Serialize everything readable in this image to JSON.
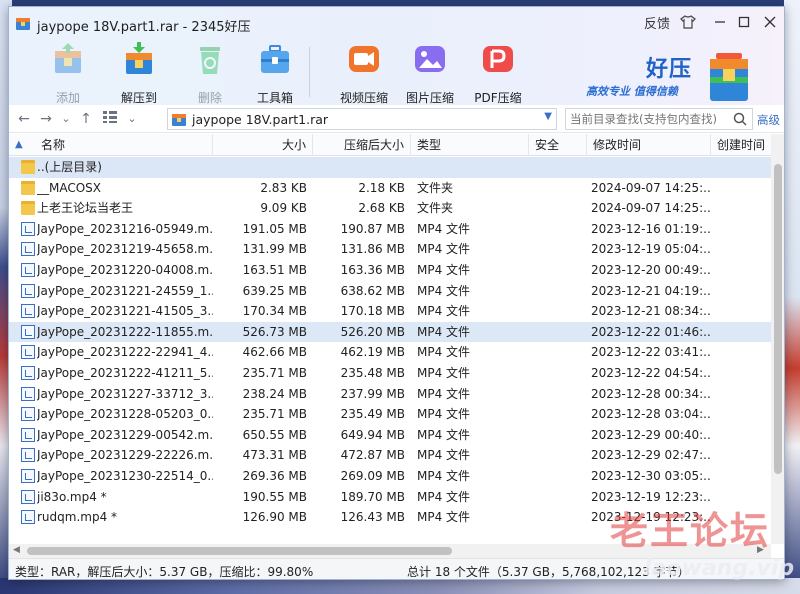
{
  "window": {
    "title": "jaypope 18V.part1.rar - 2345好压",
    "feedback": "反馈"
  },
  "toolbar": {
    "items": [
      {
        "label": "添加",
        "icon": "add-archive-icon",
        "disabled": true
      },
      {
        "label": "解压到",
        "icon": "extract-to-icon",
        "disabled": false
      },
      {
        "label": "删除",
        "icon": "delete-recycle-icon",
        "disabled": true
      },
      {
        "label": "工具箱",
        "icon": "toolbox-icon",
        "disabled": false
      },
      {
        "label": "视频压缩",
        "icon": "video-compress-icon",
        "disabled": false
      },
      {
        "label": "图片压缩",
        "icon": "image-compress-icon",
        "disabled": false
      },
      {
        "label": "PDF压缩",
        "icon": "pdf-compress-icon",
        "disabled": false
      }
    ]
  },
  "brand": {
    "name": "好压",
    "slogan": "高效专业 值得信赖"
  },
  "address": {
    "path": "jaypope 18V.part1.rar",
    "search_placeholder": "当前目录查找(支持包内查找)",
    "advanced": "高级"
  },
  "columns": {
    "name": "名称",
    "size": "大小",
    "packed": "压缩后大小",
    "type": "类型",
    "security": "安全",
    "modified": "修改时间",
    "created": "创建时间"
  },
  "rows": [
    {
      "name": "..(上层目录)",
      "size": "",
      "packed": "",
      "type": "",
      "modified": "",
      "kind": "folder"
    },
    {
      "name": "__MACOSX",
      "size": "2.83 KB",
      "packed": "2.18 KB",
      "type": "文件夹",
      "modified": "2024-09-07 14:25:...",
      "kind": "folder"
    },
    {
      "name": "上老王论坛当老王",
      "size": "9.09 KB",
      "packed": "2.68 KB",
      "type": "文件夹",
      "modified": "2024-09-07 14:25:...",
      "kind": "folder"
    },
    {
      "name": "JayPope_20231216-05949.m...",
      "size": "191.05 MB",
      "packed": "190.87 MB",
      "type": "MP4 文件",
      "modified": "2023-12-16 01:19:...",
      "kind": "file"
    },
    {
      "name": "JayPope_20231219-45658.m...",
      "size": "131.99 MB",
      "packed": "131.86 MB",
      "type": "MP4 文件",
      "modified": "2023-12-19 05:04:...",
      "kind": "file"
    },
    {
      "name": "JayPope_20231220-04008.m...",
      "size": "163.51 MB",
      "packed": "163.36 MB",
      "type": "MP4 文件",
      "modified": "2023-12-20 00:49:...",
      "kind": "file"
    },
    {
      "name": "JayPope_20231221-24559_1...",
      "size": "639.25 MB",
      "packed": "638.62 MB",
      "type": "MP4 文件",
      "modified": "2023-12-21 04:19:...",
      "kind": "file"
    },
    {
      "name": "JayPope_20231221-41505_3...",
      "size": "170.34 MB",
      "packed": "170.18 MB",
      "type": "MP4 文件",
      "modified": "2023-12-21 08:34:...",
      "kind": "file"
    },
    {
      "name": "JayPope_20231222-11855.m...",
      "size": "526.73 MB",
      "packed": "526.20 MB",
      "type": "MP4 文件",
      "modified": "2023-12-22 01:46:...",
      "kind": "file",
      "selected": true
    },
    {
      "name": "JayPope_20231222-22941_4...",
      "size": "462.66 MB",
      "packed": "462.19 MB",
      "type": "MP4 文件",
      "modified": "2023-12-22 03:41:...",
      "kind": "file"
    },
    {
      "name": "JayPope_20231222-41211_5...",
      "size": "235.71 MB",
      "packed": "235.48 MB",
      "type": "MP4 文件",
      "modified": "2023-12-22 04:54:...",
      "kind": "file"
    },
    {
      "name": "JayPope_20231227-33712_3...",
      "size": "238.24 MB",
      "packed": "237.99 MB",
      "type": "MP4 文件",
      "modified": "2023-12-28 00:34:...",
      "kind": "file"
    },
    {
      "name": "JayPope_20231228-05203_0...",
      "size": "235.71 MB",
      "packed": "235.49 MB",
      "type": "MP4 文件",
      "modified": "2023-12-28 03:04:...",
      "kind": "file"
    },
    {
      "name": "JayPope_20231229-00542.m...",
      "size": "650.55 MB",
      "packed": "649.94 MB",
      "type": "MP4 文件",
      "modified": "2023-12-29 00:40:...",
      "kind": "file"
    },
    {
      "name": "JayPope_20231229-22226.m...",
      "size": "473.31 MB",
      "packed": "472.87 MB",
      "type": "MP4 文件",
      "modified": "2023-12-29 02:47:...",
      "kind": "file"
    },
    {
      "name": "JayPope_20231230-22514_0...",
      "size": "269.36 MB",
      "packed": "269.09 MB",
      "type": "MP4 文件",
      "modified": "2023-12-30 03:05:...",
      "kind": "file"
    },
    {
      "name": "ji83o.mp4 *",
      "size": "190.55 MB",
      "packed": "189.70 MB",
      "type": "MP4 文件",
      "modified": "2023-12-19 12:23:...",
      "kind": "file"
    },
    {
      "name": "rudqm.mp4 *",
      "size": "126.90 MB",
      "packed": "126.43 MB",
      "type": "MP4 文件",
      "modified": "2023-12-19 12:23:...",
      "kind": "file"
    }
  ],
  "status": {
    "left": "类型：RAR，解压后大小：5.37 GB，压缩比：99.80%",
    "right": "总计 18 个文件（5.37 GB，5,768,102,123 字节）"
  },
  "watermark": {
    "text": "老王论坛",
    "url": "laowang.vip"
  }
}
